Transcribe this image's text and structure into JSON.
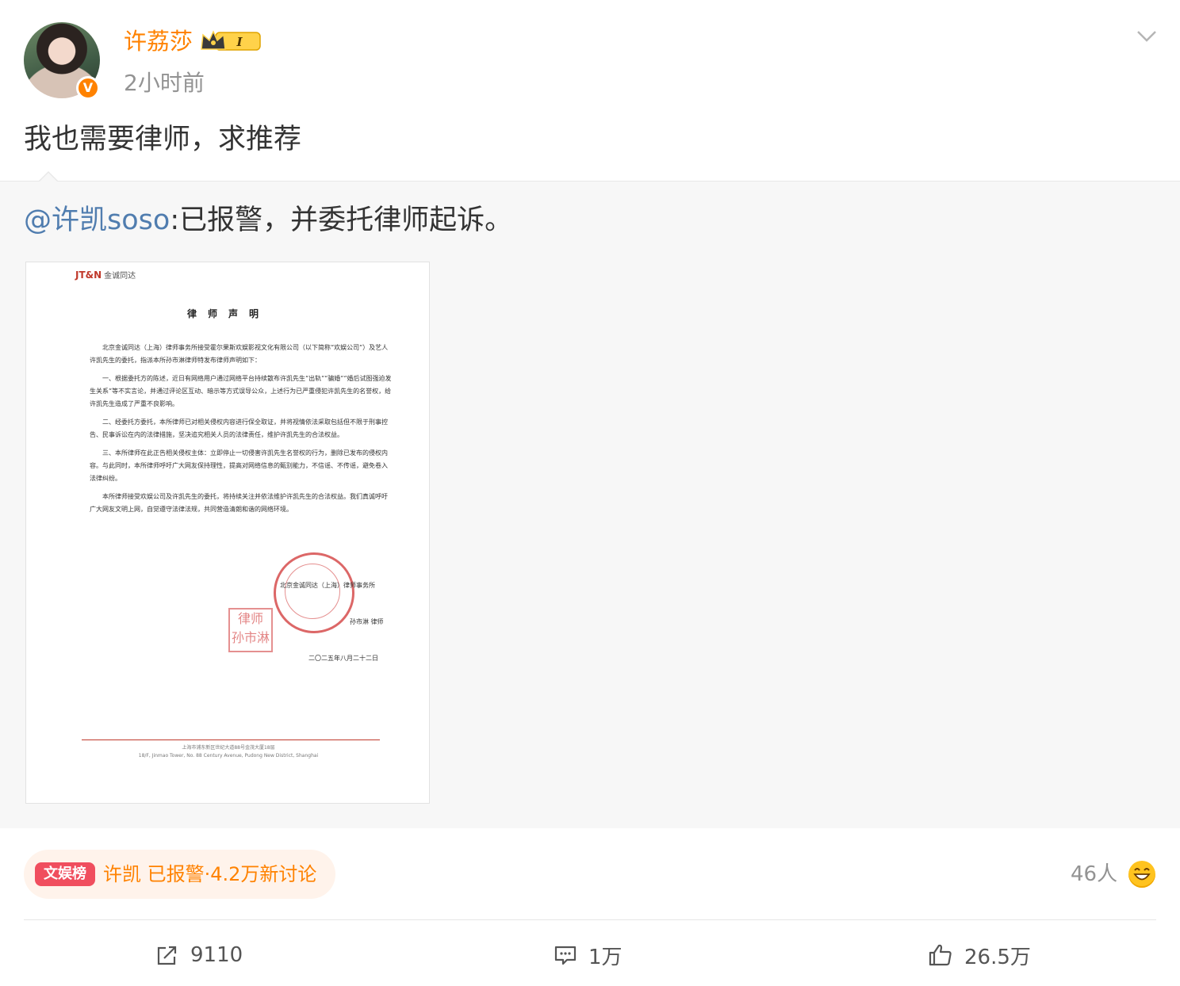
{
  "post": {
    "author": "许荔莎",
    "verified_badge": "V",
    "member_level": "I",
    "timestamp": "2小时前",
    "text": "我也需要律师，求推荐"
  },
  "repost": {
    "mention": "@许凯soso",
    "text": ":已报警，并委托律师起诉。",
    "document": {
      "logo": "JT&N",
      "logo_sub": "金诚同达",
      "title": "律师声明",
      "paragraphs": [
        "北京金诚同达（上海）律师事务所接受霍尔果斯欢娱影视文化有限公司（以下简称“欢娱公司”）及艺人许凯先生的委托，指派本所孙市淋律师特发布律师声明如下：",
        "一、根据委托方的陈述，近日有网络用户通过网络平台持续散布许凯先生“出轨”“骗婚”“婚后试图强迫发生关系”等不实言论，并通过评论区互动、暗示等方式误导公众，上述行为已严重侵犯许凯先生的名誉权，给许凯先生造成了严重不良影响。",
        "二、经委托方委托，本所律师已对相关侵权内容进行保全取证，并将视情依法采取包括但不限于刑事控告、民事诉讼在内的法律措施，坚决追究相关人员的法律责任，维护许凯先生的合法权益。",
        "三、本所律师在此正告相关侵权主体：立即停止一切侵害许凯先生名誉权的行为，删除已发布的侵权内容。与此同时，本所律师呼吁广大网友保持理性，提高对网络信息的甄别能力，不信谣、不传谣，避免卷入法律纠纷。",
        "本所律师接受欢娱公司及许凯先生的委托，将持续关注并依法维护许凯先生的合法权益。我们真诚呼吁广大网友文明上网，自觉遵守法律法规，共同营造清朗和谐的网络环境。"
      ],
      "signature_firm": "北京金诚同达（上海）律师事务所",
      "signature_lawyer": "孙市淋  律师",
      "seal_text": "律师 孙市淋",
      "date": "二〇二五年八月二十二日",
      "footer_cn": "上海市浦东新区世纪大道88号金茂大厦18层",
      "footer_en": "18/F, Jinmao Tower, No. 88 Century Avenue, Pudong New District, Shanghai"
    }
  },
  "topic": {
    "tag": "文娱榜",
    "text": "许凯 已报警·4.2万新讨论"
  },
  "reactions": {
    "count": "46人"
  },
  "actions": {
    "repost_count": "9110",
    "comment_count": "1万",
    "like_count": "26.5万"
  },
  "colors": {
    "accent": "#ff8200",
    "mention": "#507daf",
    "tag": "#f04e5e",
    "repost_bg": "#f7f7f7"
  },
  "icons": [
    "chevron-down-icon",
    "crown-icon",
    "repost-icon",
    "comment-icon",
    "like-icon",
    "laugh-emoji-icon"
  ]
}
